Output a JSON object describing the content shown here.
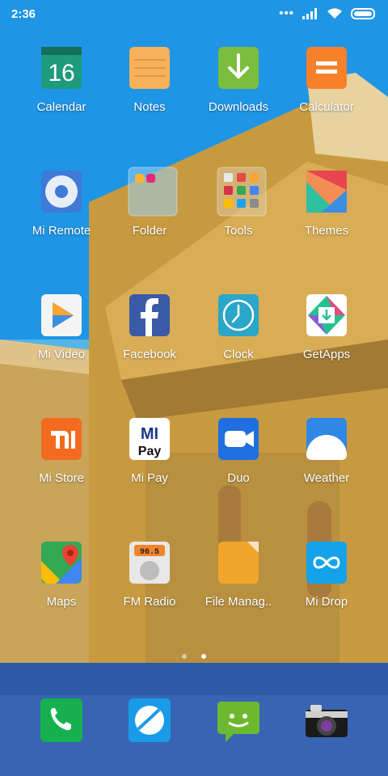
{
  "status_bar": {
    "time": "2:36"
  },
  "apps": [
    {
      "id": "calendar",
      "label": "Calendar",
      "badge": "16"
    },
    {
      "id": "notes",
      "label": "Notes"
    },
    {
      "id": "downloads",
      "label": "Downloads"
    },
    {
      "id": "calculator",
      "label": "Calculator"
    },
    {
      "id": "mi-remote",
      "label": "Mi Remote"
    },
    {
      "id": "folder",
      "label": "Folder"
    },
    {
      "id": "tools",
      "label": "Tools"
    },
    {
      "id": "themes",
      "label": "Themes"
    },
    {
      "id": "mi-video",
      "label": "Mi Video"
    },
    {
      "id": "facebook",
      "label": "Facebook"
    },
    {
      "id": "clock",
      "label": "Clock"
    },
    {
      "id": "getapps",
      "label": "GetApps"
    },
    {
      "id": "mi-store",
      "label": "Mi Store"
    },
    {
      "id": "mi-pay",
      "label": "Mi Pay",
      "icon_text_top": "MI",
      "icon_text_bottom": "Pay"
    },
    {
      "id": "duo",
      "label": "Duo"
    },
    {
      "id": "weather",
      "label": "Weather"
    },
    {
      "id": "maps",
      "label": "Maps"
    },
    {
      "id": "fm-radio",
      "label": "FM Radio",
      "icon_text": "96.5"
    },
    {
      "id": "file-manager",
      "label": "File Manag.."
    },
    {
      "id": "mi-drop",
      "label": "Mi Drop"
    }
  ],
  "page_indicator": {
    "pages": 2,
    "active": 2
  },
  "colors": {
    "calendar": "#1e9a7d",
    "notes": "#f7b15a",
    "downloads": "#7bbd3c",
    "calculator": "#f7812b",
    "mi_remote": "#3e7ad6",
    "themes": "#e9454f",
    "facebook": "#3b5aa6",
    "clock": "#2aa6c8",
    "getapps": "#27c18f",
    "mi_store": "#f46b1f",
    "duo": "#1f6fe0",
    "weather": "#2f88e6",
    "file_manager": "#f2a52b",
    "mi_drop": "#14a2ea",
    "phone": "#16b14e",
    "browser": "#1a9be8",
    "messages": "#6cb92f"
  }
}
